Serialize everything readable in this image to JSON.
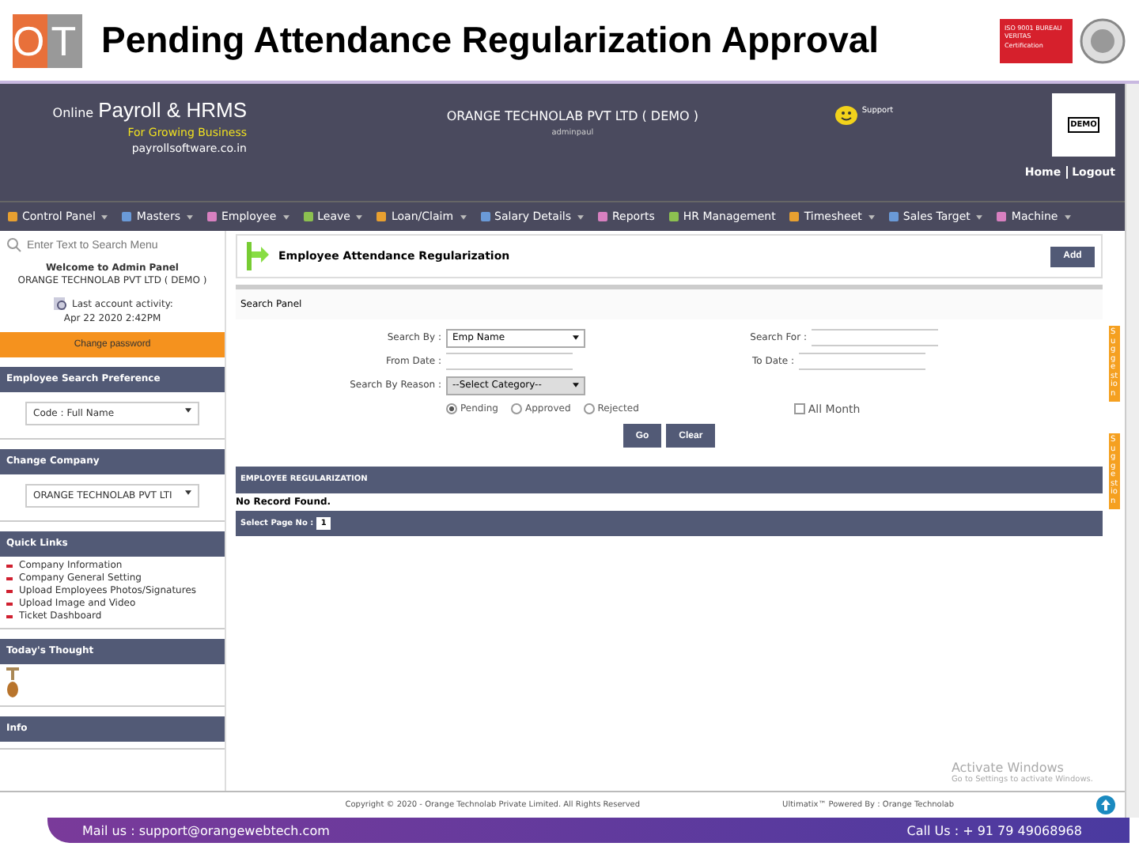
{
  "slide": {
    "logo": "OT",
    "title": "Pending Attendance Regularization Approval",
    "cert_text": "ISO 9001 BUREAU VERITAS Certification"
  },
  "app_header": {
    "brand_prefix": "Online",
    "brand": "Payroll & HRMS",
    "tagline": "For Growing Business",
    "site": "payrollsoftware.co.in",
    "company": "ORANGE TECHNOLAB PVT LTD ( DEMO )",
    "user": "adminpaul",
    "support": "Support",
    "demo_logo": "DEMO",
    "links": [
      "Home",
      "Logout"
    ]
  },
  "menu": [
    {
      "label": "Control Panel",
      "dropdown": true
    },
    {
      "label": "Masters",
      "dropdown": true
    },
    {
      "label": "Employee",
      "dropdown": true
    },
    {
      "label": "Leave",
      "dropdown": true
    },
    {
      "label": "Loan/Claim",
      "dropdown": true
    },
    {
      "label": "Salary Details",
      "dropdown": true
    },
    {
      "label": "Reports",
      "dropdown": false
    },
    {
      "label": "HR Management",
      "dropdown": false
    },
    {
      "label": "Timesheet",
      "dropdown": true
    },
    {
      "label": "Sales Target",
      "dropdown": true
    },
    {
      "label": "Machine",
      "dropdown": true
    }
  ],
  "sidebar": {
    "search_placeholder": "Enter Text to Search Menu",
    "welcome": "Welcome to Admin Panel",
    "company": "ORANGE TECHNOLAB PVT LTD ( DEMO )",
    "last_activity_label": "Last account activity:",
    "last_activity": "Apr 22 2020 2:42PM",
    "change_password": "Change password",
    "sections": [
      {
        "title": "Employee Search Preference",
        "kind": "select",
        "value": "Code : Full Name"
      },
      {
        "title": "Change Company",
        "kind": "select",
        "value": "ORANGE TECHNOLAB PVT LTI"
      },
      {
        "title": "Quick Links",
        "kind": "links",
        "links": [
          "Company Information",
          "Company General Setting",
          "Upload Employees Photos/Signatures",
          "Upload Image and Video",
          "Ticket Dashboard"
        ]
      },
      {
        "title": "Today's Thought",
        "kind": "picture"
      },
      {
        "title": "Info",
        "kind": "empty"
      }
    ]
  },
  "page": {
    "title": "Employee Attendance Regularization",
    "add_button": "Add",
    "search_panel": "Search Panel",
    "search_by_label": "Search By :",
    "search_by": "Emp Name",
    "search_for_label": "Search For :",
    "from_date_label": "From Date :",
    "to_date_label": "To Date :",
    "reason_label": "Search By Reason :",
    "reason": "--Select Category--",
    "status_options": [
      {
        "label": "Pending",
        "selected": true
      },
      {
        "label": "Approved",
        "selected": false
      },
      {
        "label": "Rejected",
        "selected": false
      }
    ],
    "all_month": {
      "label": "All Month",
      "checked": false
    },
    "buttons": [
      "Go",
      "Clear"
    ],
    "grid_title": "EMPLOYEE REGULARIZATION",
    "empty_message": "No Record Found.",
    "page_label": "Select Page No :",
    "page_value": "1",
    "side_tabs": [
      "Suggestion",
      "Suggestion"
    ]
  },
  "footer": {
    "copyright": "Copyright © 2020 - Orange Technolab Private Limited. All Rights Reserved",
    "powered": "Ultimatix™ Powered By : Orange Technolab"
  },
  "os_notice": {
    "title": "Activate Windows",
    "text": "Go to Settings to activate Windows."
  },
  "slide_footer": {
    "mail": "Mail us  : support@orangewebtech.com",
    "call": "Call Us : + 91 79 49068968"
  }
}
